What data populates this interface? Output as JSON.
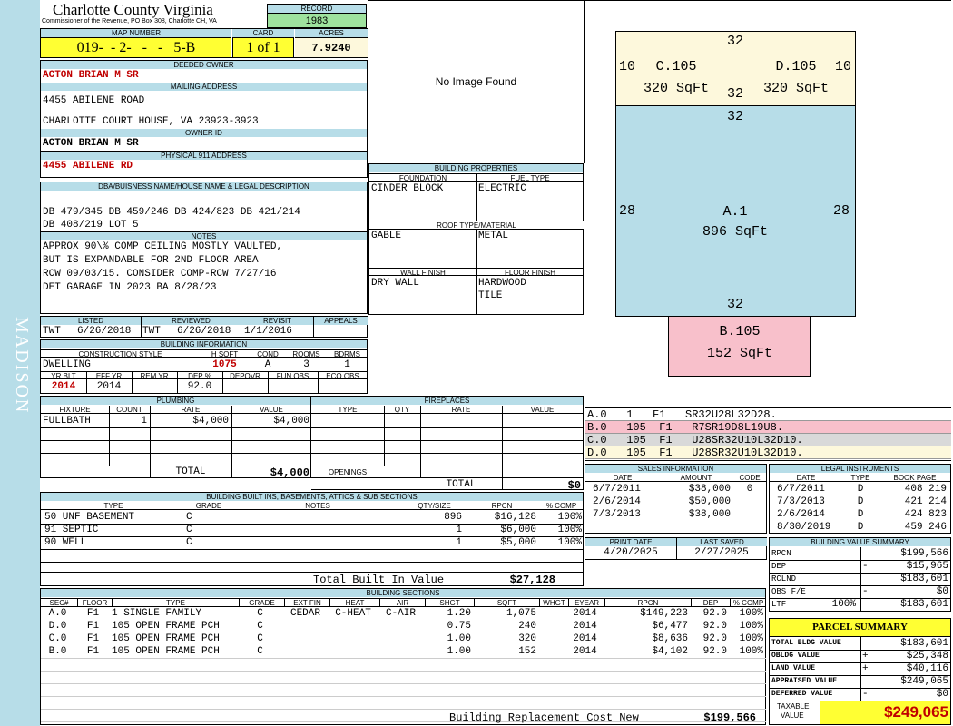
{
  "side_label": "MADISON",
  "header": {
    "county": "Charlotte County Virginia",
    "subtitle": "Commissioner of the Revenue, PO Box 308, Charlotte CH, VA",
    "record_label": "RECORD",
    "record": "1983",
    "map_label": "MAP NUMBER",
    "map_number": "019-  - 2-   -   -   5-B",
    "card_label": "CARD",
    "card": "1 of 1",
    "acres_label": "ACRES",
    "acres": "7.9240"
  },
  "owner": {
    "deeded_label": "DEEDED OWNER",
    "deeded_owner": "ACTON BRIAN M SR",
    "mailing_label": "MAILING ADDRESS",
    "mailing_1": "4455 ABILENE ROAD",
    "mailing_2": "CHARLOTTE COURT HOUSE, VA 23923-3923",
    "owner_id_label": "OWNER ID",
    "owner_id": "ACTON BRIAN M SR",
    "physical_label": "PHYSICAL 911 ADDRESS",
    "physical": "4455 ABILENE RD",
    "legal_label": "DBA/BUISNESS NAME/HOUSE NAME & LEGAL DESCRIPTION",
    "legal_1": "DB 479/345 DB 459/246 DB 424/823 DB 421/214",
    "legal_2": "DB 408/219 LOT 5",
    "notes_label": "NOTES",
    "notes": [
      "APPROX 90\\% COMP CEILING MOSTLY VAULTED,",
      "BUT IS EXPANDABLE FOR 2ND FLOOR AREA",
      "RCW 09/03/15. CONSIDER COMP-RCW 7/27/16",
      "DET GARAGE IN 2023 BA 8/28/23"
    ]
  },
  "photo": {
    "no_image": "No Image Found"
  },
  "listing": {
    "listed_label": "LISTED",
    "listed_by": "TWT",
    "listed": "6/26/2018",
    "reviewed_label": "REVIEWED",
    "reviewed_by": "TWT",
    "reviewed": "6/26/2018",
    "revisit_label": "REVISIT",
    "revisit": "1/1/2016",
    "appeals_label": "APPEALS",
    "appeals": ""
  },
  "building_info": {
    "title": "BUILDING INFORMATION",
    "style_label": "CONSTRUCTION STYLE",
    "style": "DWELLING",
    "hsqft_label": "H SQFT",
    "hsqft": "1075",
    "cond_label": "COND",
    "cond": "A",
    "rooms_label": "ROOMS",
    "rooms": "3",
    "bdrms_label": "BDRMS",
    "bdrms": "1",
    "yrblt_label": "YR BLT",
    "yrblt": "2014",
    "effyr_label": "EFF YR",
    "effyr": "2014",
    "remyr_label": "REM YR",
    "remyr": "",
    "dep_label": "DEP %",
    "dep": "92.0",
    "depovr_label": "DEPOVR",
    "depovr": "",
    "funobs_label": "FUN OBS",
    "funobs": "",
    "ecoobs_label": "ECO OBS",
    "ecoobs": ""
  },
  "props": {
    "title": "BUILDING PROPERTIES",
    "foundation_label": "FOUNDATION",
    "foundation": "CINDER BLOCK",
    "fuel_label": "FUEL TYPE",
    "fuel": "ELECTRIC",
    "roof_label": "ROOF TYPE/MATERIAL",
    "roof_type": "GABLE",
    "roof_material": "METAL",
    "wall_label": "WALL FINISH",
    "wall": "DRY WALL",
    "floor_label": "FLOOR FINISH",
    "floor_1": "HARDWOOD",
    "floor_2": "TILE"
  },
  "sketch": {
    "c_label": "C.105",
    "c_area": "320 SqFt",
    "d_label": "D.105",
    "d_area": "320 SqFt",
    "a_label": "A.1",
    "a_area": "896 SqFt",
    "b_label": "B.105",
    "b_area": "152 SqFt",
    "dim_top": "32",
    "dim_mid": "32",
    "dim_a_top": "32",
    "dim_a_bot": "32",
    "dim_cd_left": "10",
    "dim_cd_right": "10",
    "dim_a_left": "28",
    "dim_a_right": "28",
    "colors": {
      "top": "#fdf8dc",
      "a": "#b7dde8",
      "b": "#f8c0cb"
    }
  },
  "codes": [
    {
      "text": "A.0   1   F1   SR32U28L32D28.",
      "color": "#ffffff"
    },
    {
      "text": "B.0   105  F1   R7SR19D8L19U8.",
      "color": "#f8c0cb"
    },
    {
      "text": "C.0   105  F1   U28SR32U10L32D10.",
      "color": "#d9d9d9"
    },
    {
      "text": "D.0   105  F1   U28SR32U10L32D10.",
      "color": "#fdf8dc"
    }
  ],
  "plumbing": {
    "title": "PLUMBING",
    "headers": [
      "FIXTURE",
      "COUNT",
      "RATE",
      "VALUE"
    ],
    "rows": [
      [
        "FULLBATH",
        "1",
        "$4,000",
        "$4,000"
      ],
      [
        "",
        "",
        "",
        ""
      ],
      [
        "",
        "",
        "",
        ""
      ],
      [
        "",
        "",
        "",
        ""
      ]
    ],
    "total_label": "TOTAL",
    "total": "$4,000"
  },
  "fireplaces": {
    "title": "FIREPLACES",
    "headers": [
      "TYPE",
      "QTY",
      "RATE",
      "VALUE"
    ],
    "openings": "OPENINGS",
    "total_label": "TOTAL",
    "total": "$0"
  },
  "sales": {
    "title": "SALES INFORMATION",
    "headers": [
      "DATE",
      "AMOUNT",
      "CODE"
    ],
    "rows": [
      [
        "6/7/2011",
        "$38,000",
        "0"
      ],
      [
        "2/6/2014",
        "$50,000",
        ""
      ],
      [
        "7/3/2013",
        "$38,000",
        ""
      ]
    ]
  },
  "legal_instruments": {
    "title": "LEGAL INSTRUMENTS",
    "headers": [
      "DATE",
      "TYPE",
      "BOOK PAGE"
    ],
    "rows": [
      [
        "6/7/2011",
        "D",
        "408 219"
      ],
      [
        "7/3/2013",
        "D",
        "421 214"
      ],
      [
        "2/6/2014",
        "D",
        "424 823"
      ],
      [
        "8/30/2019",
        "D",
        "459 246"
      ]
    ]
  },
  "print": {
    "print_label": "PRINT DATE",
    "print_date": "4/20/2025",
    "saved_label": "LAST SAVED",
    "saved": "2/27/2025"
  },
  "builtins": {
    "title": "BUILDING BUILT INS, BASEMENTS, ATTICS & SUB SECTIONS",
    "headers": [
      "TYPE",
      "GRADE",
      "NOTES",
      "QTY/SIZE",
      "RPCN",
      "% COMP"
    ],
    "rows": [
      [
        "50 UNF BASEMENT",
        "C",
        "",
        "896",
        "$16,128",
        "100%"
      ],
      [
        "91 SEPTIC",
        "C",
        "",
        "1",
        "$6,000",
        "100%"
      ],
      [
        "90 WELL",
        "C",
        "",
        "1",
        "$5,000",
        "100%"
      ]
    ],
    "total_label": "Total Built In Value",
    "total": "$27,128"
  },
  "value_summary": {
    "title": "BUILDING VALUE SUMMARY",
    "rows": [
      {
        "label": "RPCN",
        "sign": "",
        "pct": "",
        "value": "$199,566"
      },
      {
        "label": "DEP",
        "sign": "-",
        "pct": "",
        "value": "$15,965"
      },
      {
        "label": "RCLND",
        "sign": "",
        "pct": "",
        "value": "$183,601"
      },
      {
        "label": "OBS F/E",
        "sign": "-",
        "pct": "",
        "value": "$0"
      },
      {
        "label": "LTF",
        "sign": "",
        "pct": "100%",
        "value": "$183,601"
      }
    ]
  },
  "parcel": {
    "title": "PARCEL SUMMARY",
    "rows": [
      {
        "label": "TOTAL BLDG VALUE",
        "sign": "",
        "value": "$183,601"
      },
      {
        "label": "OBLDG VALUE",
        "sign": "+",
        "value": "$25,348"
      },
      {
        "label": "LAND VALUE",
        "sign": "+",
        "value": "$40,116"
      },
      {
        "label": "APPRAISED VALUE",
        "sign": "",
        "value": "$249,065"
      },
      {
        "label": "DEFERRED VALUE",
        "sign": "-",
        "value": "$0"
      }
    ],
    "taxable_label_1": "TAXABLE",
    "taxable_label_2": "VALUE",
    "taxable": "$249,065"
  },
  "sections": {
    "title": "BUILDING SECTIONS",
    "headers": [
      "SEC#",
      "FLOOR",
      "TYPE",
      "GRADE",
      "EXT FIN",
      "HEAT",
      "AIR",
      "SHGT",
      "SQFT",
      "WHGT",
      "EYEAR",
      "RPCN",
      "DEP",
      "% COMP"
    ],
    "rows": [
      [
        "A.0",
        "F1",
        "1 SINGLE FAMILY",
        "C",
        "CEDAR",
        "C-HEAT",
        "C-AIR",
        "1.20",
        "1,075",
        "",
        "2014",
        "$149,223",
        "92.0",
        "100%"
      ],
      [
        "D.0",
        "F1",
        "105 OPEN FRAME PCH",
        "C",
        "",
        "",
        "",
        "0.75",
        "240",
        "",
        "2014",
        "$6,477",
        "92.0",
        "100%"
      ],
      [
        "C.0",
        "F1",
        "105 OPEN FRAME PCH",
        "C",
        "",
        "",
        "",
        "1.00",
        "320",
        "",
        "2014",
        "$8,636",
        "92.0",
        "100%"
      ],
      [
        "B.0",
        "F1",
        "105 OPEN FRAME PCH",
        "C",
        "",
        "",
        "",
        "1.00",
        "152",
        "",
        "2014",
        "$4,102",
        "92.0",
        "100%"
      ]
    ],
    "rcn_label": "Building Replacement Cost New",
    "rcn": "$199,566"
  }
}
